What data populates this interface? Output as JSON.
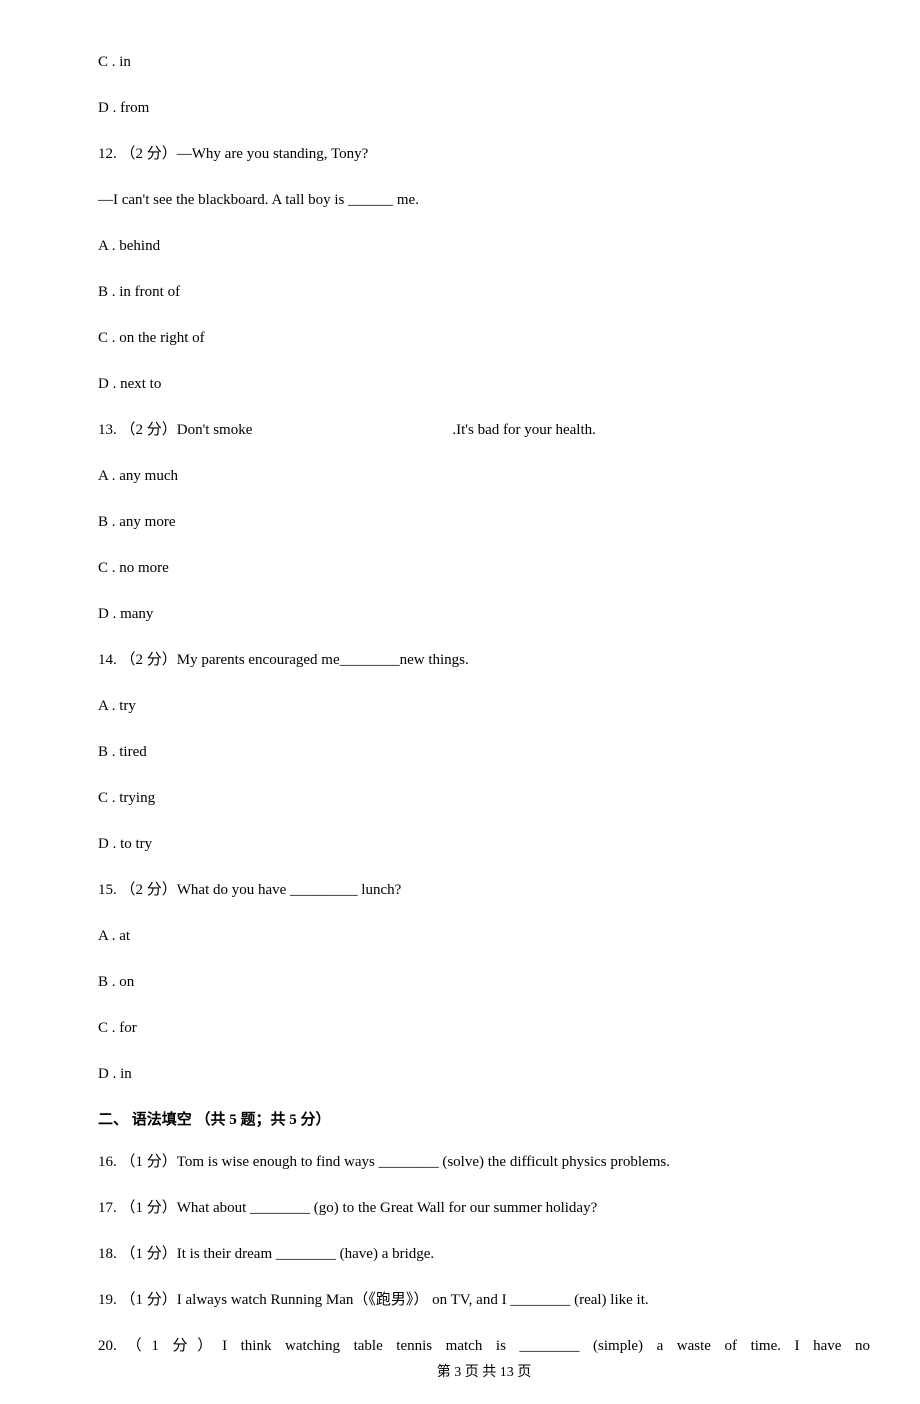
{
  "q11": {
    "optC": "C . in",
    "optD": "D . from"
  },
  "q12": {
    "prompt_a": "12. （2 分）—Why are you standing, Tony?",
    "prompt_b": "—I can't see the blackboard. A tall boy is ______ me.",
    "optA": "A . behind",
    "optB": "B . in front of",
    "optC": "C . on the right of",
    "optD": "D . next to"
  },
  "q13": {
    "prompt_pre": "13. （2 分）Don't smoke",
    "prompt_post": ".It's bad for your health.",
    "optA": "A . any much",
    "optB": "B . any more",
    "optC": "C . no more",
    "optD": "D . many"
  },
  "q14": {
    "prompt": "14. （2 分）My parents encouraged me________new things.",
    "optA": "A . try",
    "optB": "B . tired",
    "optC": "C . trying",
    "optD": "D . to try"
  },
  "q15": {
    "prompt": "15. （2 分）What do you have _________ lunch?",
    "optA": "A . at",
    "optB": "B . on",
    "optC": "C . for",
    "optD": "D . in"
  },
  "section2": {
    "header": "二、 语法填空 （共 5 题；共 5 分）"
  },
  "q16": {
    "text": "16. （1 分）Tom is wise enough to find ways ________ (solve) the difficult physics problems."
  },
  "q17": {
    "text": "17. （1 分）What about ________ (go) to the Great Wall for our summer holiday?"
  },
  "q18": {
    "text": "18. （1 分）It is their dream ________  (have) a bridge."
  },
  "q19": {
    "text": "19. （1 分）I always watch Running Man（《跑男》） on TV, and I ________ (real) like it."
  },
  "q20": {
    "text": "20.（1 分）I think watching table tennis match is ________ (simple) a waste of time. I have no"
  },
  "footer": {
    "text": "第 3 页 共 13 页"
  }
}
